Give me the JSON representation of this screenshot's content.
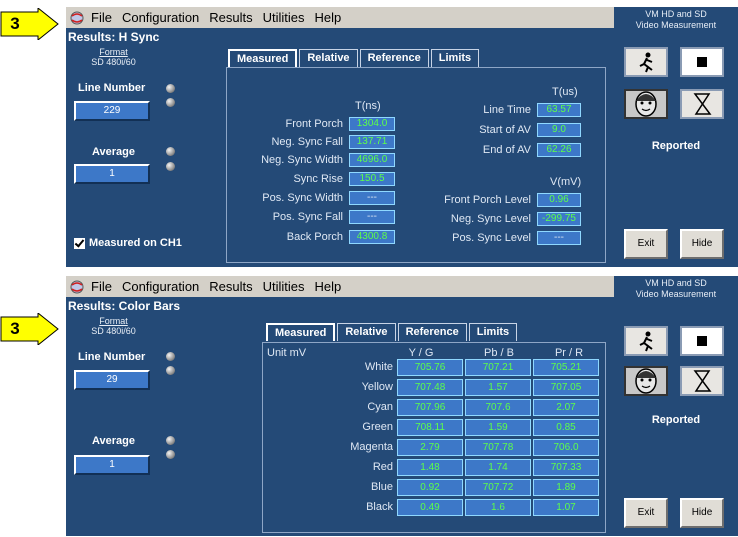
{
  "top": {
    "callout_number": "3",
    "menu": [
      "File",
      "Configuration",
      "Results",
      "Utilities",
      "Help"
    ],
    "app_title": [
      "VM HD and SD",
      "Video Measurement"
    ],
    "results_title": "Results: H Sync",
    "format_label": "Format",
    "format_value": "SD 480i/60",
    "line_number_label": "Line Number",
    "line_number_value": "229",
    "average_label": "Average",
    "average_value": "1",
    "measured_on": "Measured on CH1",
    "tabs": [
      "Measured",
      "Relative",
      "Reference",
      "Limits"
    ],
    "col_tns": "T(ns)",
    "col_tus": "T(us)",
    "col_vmv": "V(mV)",
    "left_rows": [
      {
        "label": "Front Porch",
        "value": "1304.0"
      },
      {
        "label": "Neg. Sync Fall",
        "value": "137.71"
      },
      {
        "label": "Neg. Sync Width",
        "value": "4696.0"
      },
      {
        "label": "Sync Rise",
        "value": "150.5"
      },
      {
        "label": "Pos. Sync Width",
        "value": "---"
      },
      {
        "label": "Pos. Sync Fall",
        "value": "---"
      },
      {
        "label": "Back Porch",
        "value": "4300.8"
      }
    ],
    "time_rows": [
      {
        "label": "Line Time",
        "value": "63.57"
      },
      {
        "label": "Start of AV",
        "value": "9.0"
      },
      {
        "label": "End of AV",
        "value": "62.26"
      }
    ],
    "volt_rows": [
      {
        "label": "Front Porch Level",
        "value": "0.96"
      },
      {
        "label": "Neg. Sync Level",
        "value": "-299.75"
      },
      {
        "label": "Pos. Sync Level",
        "value": "---"
      }
    ],
    "reported": "Reported",
    "exit": "Exit",
    "hide": "Hide"
  },
  "bottom": {
    "callout_number": "3",
    "menu": [
      "File",
      "Configuration",
      "Results",
      "Utilities",
      "Help"
    ],
    "app_title": [
      "VM HD and SD",
      "Video Measurement"
    ],
    "results_title": "Results: Color Bars",
    "format_label": "Format",
    "format_value": "SD 480i/60",
    "line_number_label": "Line Number",
    "line_number_value": "29",
    "average_label": "Average",
    "average_value": "1",
    "tabs": [
      "Measured",
      "Relative",
      "Reference",
      "Limits"
    ],
    "unit_label": "Unit mV",
    "col_headers": [
      "Y / G",
      "Pb / B",
      "Pr / R"
    ],
    "rows": [
      {
        "name": "White",
        "values": [
          "705.76",
          "707.21",
          "705.21"
        ]
      },
      {
        "name": "Yellow",
        "values": [
          "707.48",
          "1.57",
          "707.05"
        ]
      },
      {
        "name": "Cyan",
        "values": [
          "707.96",
          "707.6",
          "2.07"
        ]
      },
      {
        "name": "Green",
        "values": [
          "708.11",
          "1.59",
          "0.85"
        ]
      },
      {
        "name": "Magenta",
        "values": [
          "2.79",
          "707.78",
          "706.0"
        ]
      },
      {
        "name": "Red",
        "values": [
          "1.48",
          "1.74",
          "707.33"
        ]
      },
      {
        "name": "Blue",
        "values": [
          "0.92",
          "707.72",
          "1.89"
        ]
      },
      {
        "name": "Black",
        "values": [
          "0.49",
          "1.6",
          "1.07"
        ]
      }
    ],
    "reported": "Reported",
    "exit": "Exit",
    "hide": "Hide"
  },
  "colors": {
    "panel_bg": "#244a77",
    "field_bg": "#3d78c8",
    "value_green": "#5cff4a",
    "callout_yellow": "#ffff00",
    "menubar_gray": "#d4d0c8"
  }
}
